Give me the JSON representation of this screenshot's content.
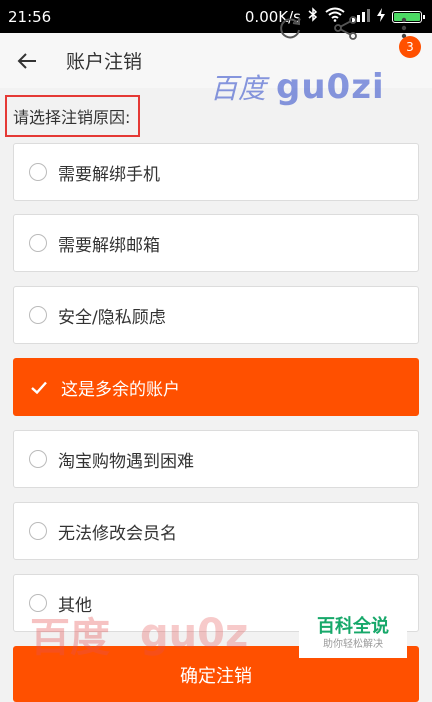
{
  "status_bar": {
    "time": "21:56",
    "net_speed": "0.00K/s"
  },
  "header": {
    "title": "账户注销",
    "badge_count": "3"
  },
  "prompt": "请选择注销原因:",
  "options": [
    {
      "label": "需要解绑手机",
      "selected": false
    },
    {
      "label": "需要解绑邮箱",
      "selected": false
    },
    {
      "label": "安全/隐私顾虑",
      "selected": false
    },
    {
      "label": "这是多余的账户",
      "selected": true
    },
    {
      "label": "淘宝购物遇到困难",
      "selected": false
    },
    {
      "label": "无法修改会员名",
      "selected": false
    },
    {
      "label": "其他",
      "selected": false
    }
  ],
  "confirm_label": "确定注销",
  "watermark": {
    "top_cn": "百度",
    "top_en": "gu0zi",
    "bottom_cn": "百度",
    "bottom_en": "gu0z"
  },
  "logo": {
    "main": "百科全说",
    "sub": "助你轻松解决"
  },
  "colors": {
    "accent": "#ff5000",
    "prompt_border": "#e53935",
    "logo_green": "#17a86a"
  }
}
